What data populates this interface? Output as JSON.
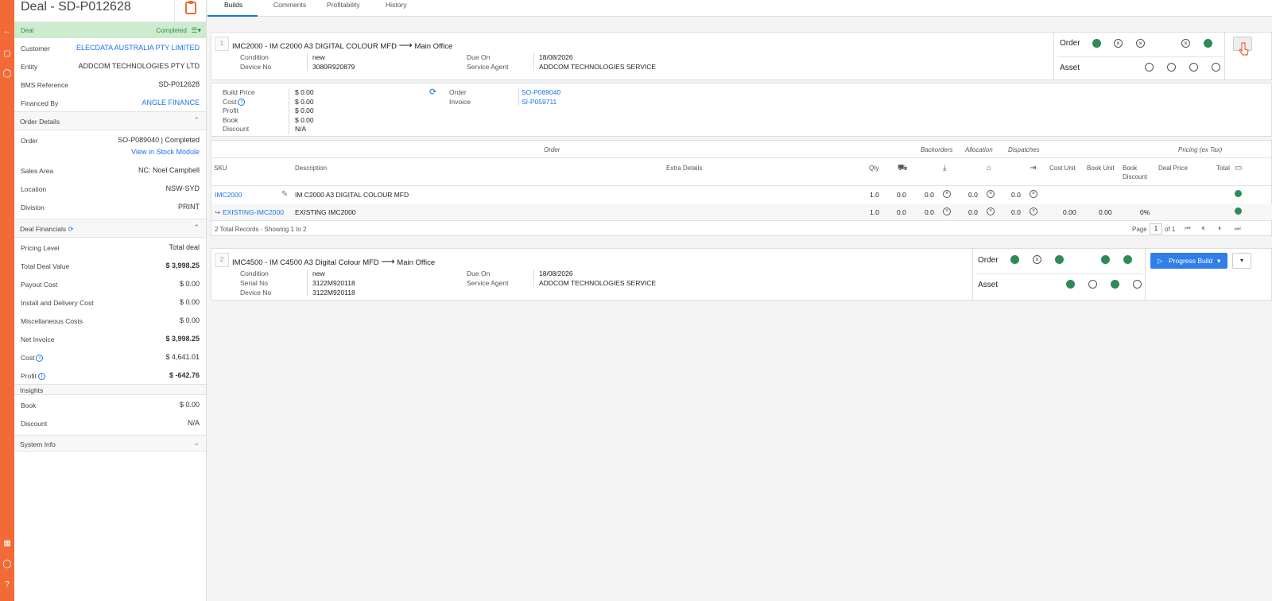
{
  "deal": {
    "title": "Deal - SD-P012628",
    "status_label": "Deal",
    "status_value": "Completed"
  },
  "fields": [
    {
      "k": "Customer",
      "v": "ELECDATA AUSTRALIA PTY LIMITED"
    },
    {
      "k": "Entity",
      "v": "ADDCOM TECHNOLOGIES PTY LTD"
    },
    {
      "k": "BMS Reference",
      "v": "SD-P012628"
    },
    {
      "k": "Financed By",
      "v": "ANGLE FINANCE"
    }
  ],
  "order_details": {
    "title": "Order Details",
    "order_label": "Order",
    "order_value": "SO-P089040 | Completed",
    "stock_link": "View in Stock Module",
    "rows": [
      {
        "k": "Sales Area",
        "v": "NC: Noel Campbell"
      },
      {
        "k": "Location",
        "v": "NSW-SYD"
      },
      {
        "k": "Division",
        "v": "PRINT"
      }
    ]
  },
  "financials": {
    "title": "Deal Financials",
    "rows": [
      {
        "k": "Pricing Level",
        "v": "Total deal"
      },
      {
        "k": "Total Deal Value",
        "v": "$ 3,998.25"
      },
      {
        "k": "Payout Cost",
        "v": "$ 0.00"
      },
      {
        "k": "Install and Delivery Cost",
        "v": "$ 0.00"
      },
      {
        "k": "Miscellaneous Costs",
        "v": "$ 0.00"
      },
      {
        "k": "Net Invoice",
        "v": "$ 3,998.25"
      },
      {
        "k": "Cost",
        "v": "$ 4,641.01"
      },
      {
        "k": "Profit",
        "v": "$ -642.76"
      }
    ]
  },
  "insights": {
    "title": "Insights",
    "rows": [
      {
        "k": "Book",
        "v": "$ 0.00"
      },
      {
        "k": "Discount",
        "v": "N/A"
      }
    ]
  },
  "system_info": "System Info",
  "tabs": [
    "Builds",
    "Comments",
    "Profitability",
    "History"
  ],
  "build1": {
    "num": "1",
    "title": "IMC2000 - IM C2000 A3 DIGITAL COLOUR MFD",
    "dest": "Main Office",
    "condition_label": "Condition",
    "condition": "new",
    "device_label": "Device No",
    "device": "3080R920879",
    "due_label": "Due On",
    "due": "18/08/2026",
    "agent_label": "Service Agent",
    "agent": "ADDCOM TECHNOLOGIES SERVICE",
    "order_label": "Order",
    "asset_label": "Asset",
    "pricing": [
      {
        "k": "Build Price",
        "v": "$ 0.00"
      },
      {
        "k": "Cost",
        "v": "$ 0.00"
      },
      {
        "k": "Profit",
        "v": "$ 0.00"
      },
      {
        "k": "Book",
        "v": "$ 0.00"
      },
      {
        "k": "Discount",
        "v": "N/A"
      }
    ],
    "links": [
      {
        "k": "Order",
        "v": "SO-P089040"
      },
      {
        "k": "Invoice",
        "v": "SI-P059711"
      }
    ]
  },
  "table": {
    "group_order": "Order",
    "group_backorders": "Backorders",
    "group_allocation": "Allocation",
    "group_dispatches": "Dispatches",
    "group_pricing": "Pricing (ex Tax)",
    "headers": {
      "sku": "SKU",
      "desc": "Description",
      "extra": "Extra Details",
      "qty": "Qty",
      "cost_unit": "Cost Unit",
      "book_unit": "Book Unit",
      "book_discount_1": "Book",
      "book_discount_2": "Discount",
      "deal_price": "Deal Price",
      "total": "Total"
    },
    "rows": [
      {
        "sku": "IMC2000",
        "desc": "IM C2000 A3 DIGITAL COLOUR MFD",
        "qty": "1.0",
        "a": "0.0",
        "b": "0.0",
        "c": "0.0",
        "d": "0.0",
        "cost_unit": "",
        "book_unit": "",
        "disc": ""
      },
      {
        "sku": "EXISTING-IMC2000",
        "desc": "EXISTING IMC2000",
        "qty": "1.0",
        "a": "0.0",
        "b": "0.0",
        "c": "0.0",
        "d": "0.0",
        "cost_unit": "0.00",
        "book_unit": "0.00",
        "disc": "0%"
      }
    ],
    "records": "2 Total Records - Showing 1 to 2",
    "page_label": "Page",
    "page": "1",
    "of": "of 1"
  },
  "build2": {
    "num": "2",
    "title": "IMC4500 - IM C4500 A3 Digital Colour MFD",
    "dest": "Main Office",
    "condition_label": "Condition",
    "condition": "new",
    "serial_label": "Serial No",
    "serial": "3122M920118",
    "device_label": "Device No",
    "device": "3122M920118",
    "due_label": "Due On",
    "due": "18/08/2026",
    "agent_label": "Service Agent",
    "agent": "ADDCOM TECHNOLOGIES SERVICE",
    "order_label": "Order",
    "asset_label": "Asset",
    "progress": "Progress Build"
  },
  "colors": {
    "accent": "#f26b36",
    "link": "#1a73e8",
    "status_green": "#2e8b57",
    "completed_bg": "#cdeccf"
  }
}
